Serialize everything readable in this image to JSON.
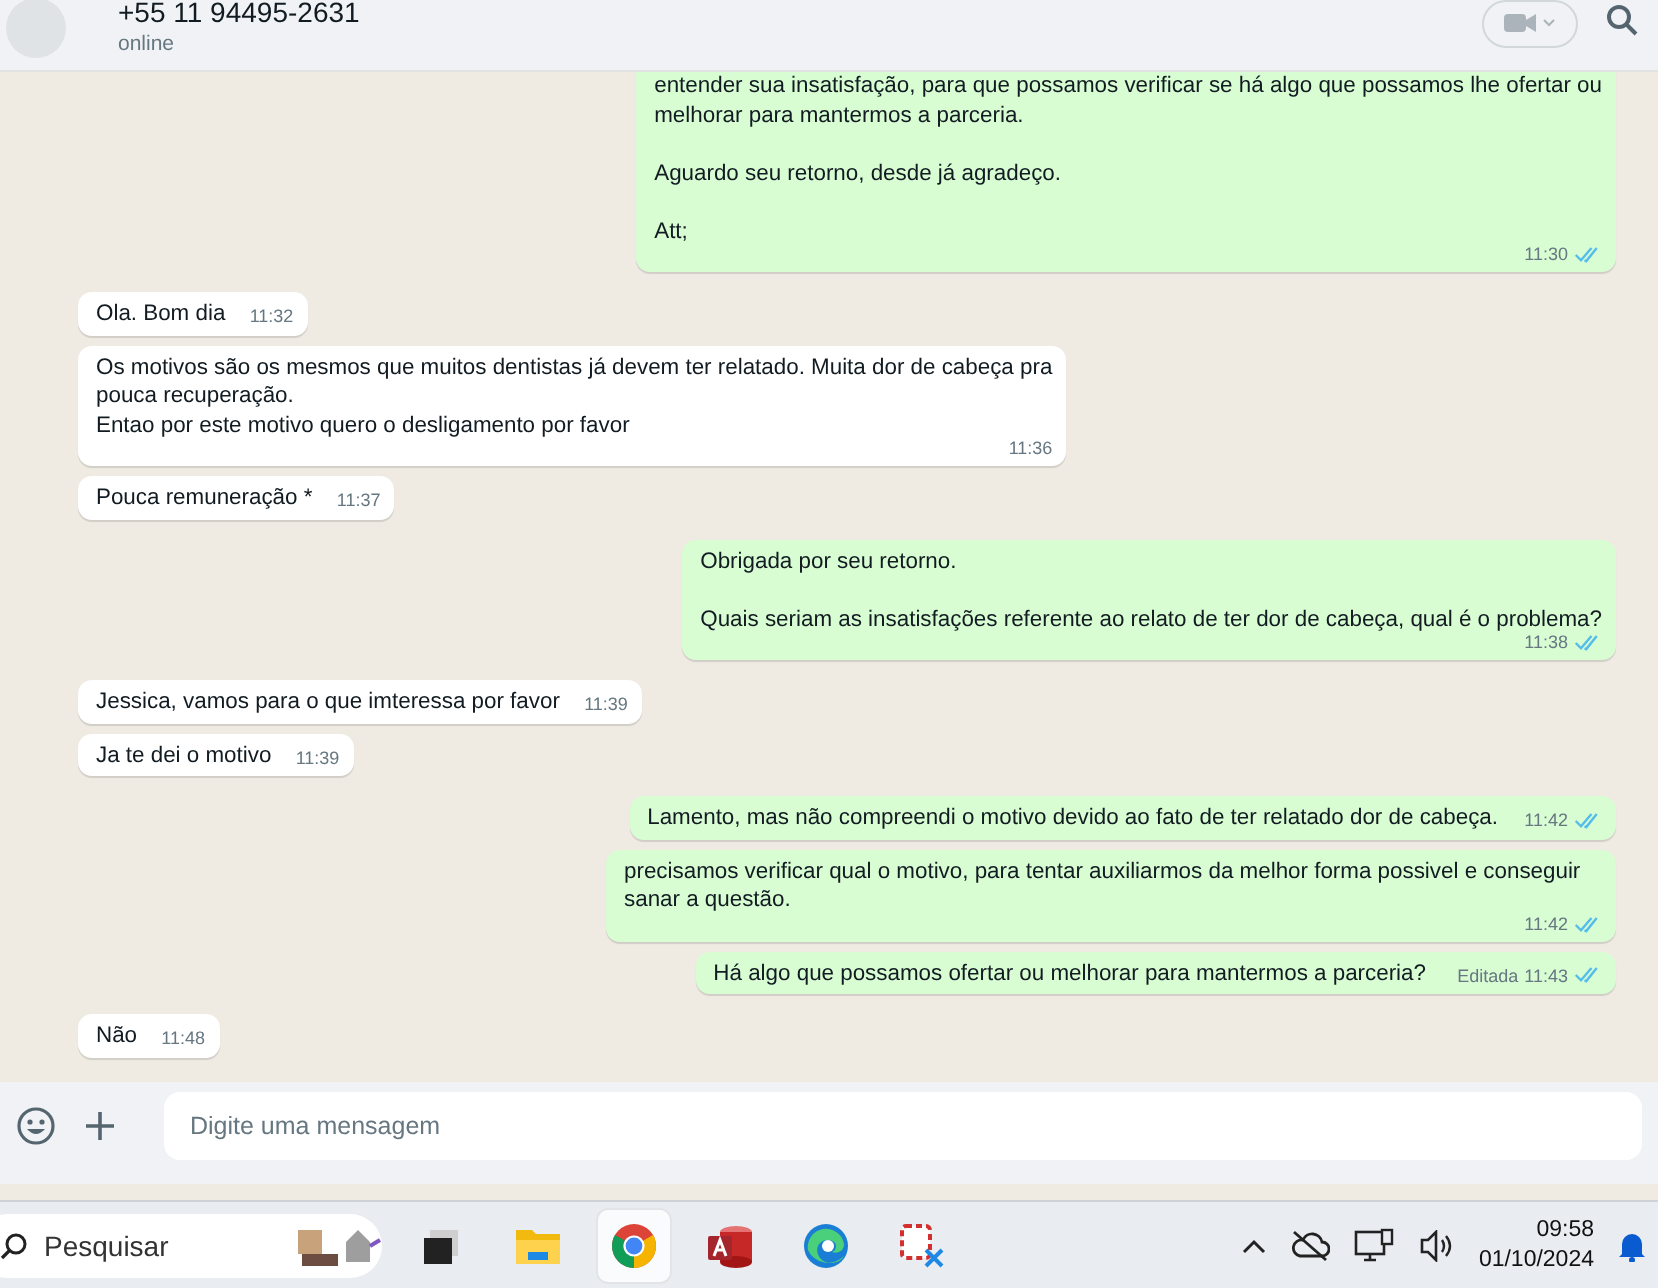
{
  "chat_header": {
    "contact": "+55 11 94495-2631",
    "status": "online"
  },
  "messages": [
    {
      "kind": "outgoing",
      "text": "entender sua insatisfação, para que possamos verificar se há algo que possamos lhe ofertar ou\nmelhorar para mantermos a parceria.\n\nAguardo seu retorno, desde já agradeço.\n\nAtt;",
      "time": "11:30",
      "read": true
    },
    {
      "kind": "incoming",
      "text": "Ola. Bom dia",
      "time": "11:32"
    },
    {
      "kind": "incoming",
      "text": "Os motivos são os mesmos que muitos dentistas já devem ter relatado. Muita dor de cabeça pra\npouca recuperação.\nEntao por este motivo quero o desligamento por favor",
      "time": "11:36"
    },
    {
      "kind": "incoming",
      "text": "Pouca remuneração *",
      "time": "11:37"
    },
    {
      "kind": "outgoing",
      "text": "Obrigada por seu retorno.\n\nQuais seriam as insatisfações referente ao relato de ter dor de cabeça, qual é o problema?",
      "time": "11:38",
      "read": true
    },
    {
      "kind": "incoming",
      "text": "Jessica, vamos para o que imteressa por favor",
      "time": "11:39"
    },
    {
      "kind": "incoming",
      "text": "Ja te dei o motivo",
      "time": "11:39"
    },
    {
      "kind": "outgoing",
      "text": "Lamento, mas não compreendi o motivo devido ao fato de ter relatado dor de cabeça.",
      "time": "11:42",
      "read": true
    },
    {
      "kind": "outgoing",
      "text": "precisamos verificar qual o motivo, para tentar auxiliarmos da melhor forma possivel e conseguir sanar a questão.",
      "time": "11:42",
      "read": true
    },
    {
      "kind": "outgoing",
      "text": "Há algo que possamos ofertar ou melhorar para mantermos a parceria?",
      "edited": "Editada",
      "time": "11:43",
      "read": true
    },
    {
      "kind": "incoming",
      "text": "Não",
      "time": "11:48"
    }
  ],
  "composer": {
    "placeholder": "Digite uma mensagem"
  },
  "taskbar": {
    "search": {
      "placeholder": "Pesquisar"
    },
    "apps": [
      {
        "kind": "taskview",
        "selected": false
      },
      {
        "kind": "folder",
        "selected": false
      },
      {
        "kind": "chrome",
        "selected": true
      },
      {
        "kind": "access",
        "selected": false
      },
      {
        "kind": "edge",
        "selected": false
      },
      {
        "kind": "snip",
        "selected": false
      }
    ],
    "time": "09:58",
    "date": "01/10/2024"
  }
}
